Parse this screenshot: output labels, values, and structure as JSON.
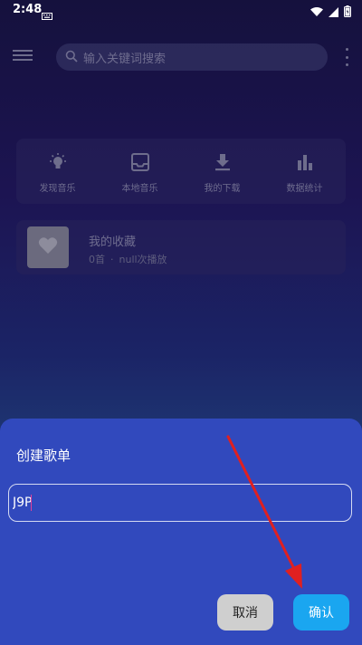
{
  "status_bar": {
    "time": "2:48"
  },
  "search": {
    "placeholder": "输入关键词搜索"
  },
  "quick_actions": [
    {
      "label": "发现音乐",
      "icon": "lightbulb-icon"
    },
    {
      "label": "本地音乐",
      "icon": "inbox-icon"
    },
    {
      "label": "我的下载",
      "icon": "download-icon"
    },
    {
      "label": "数据统计",
      "icon": "bar-chart-icon"
    }
  ],
  "favorites": {
    "title": "我的收藏",
    "count": "0首",
    "separator": "·",
    "plays": "null次播放"
  },
  "dialog": {
    "title": "创建歌单",
    "input_value": "J9P",
    "cancel_label": "取消",
    "confirm_label": "确认"
  },
  "colors": {
    "sheet_bg": "#3149bd",
    "confirm_bg": "#1aa6f0",
    "cancel_bg": "#cfcfcf",
    "annotation_arrow": "#e02020"
  }
}
